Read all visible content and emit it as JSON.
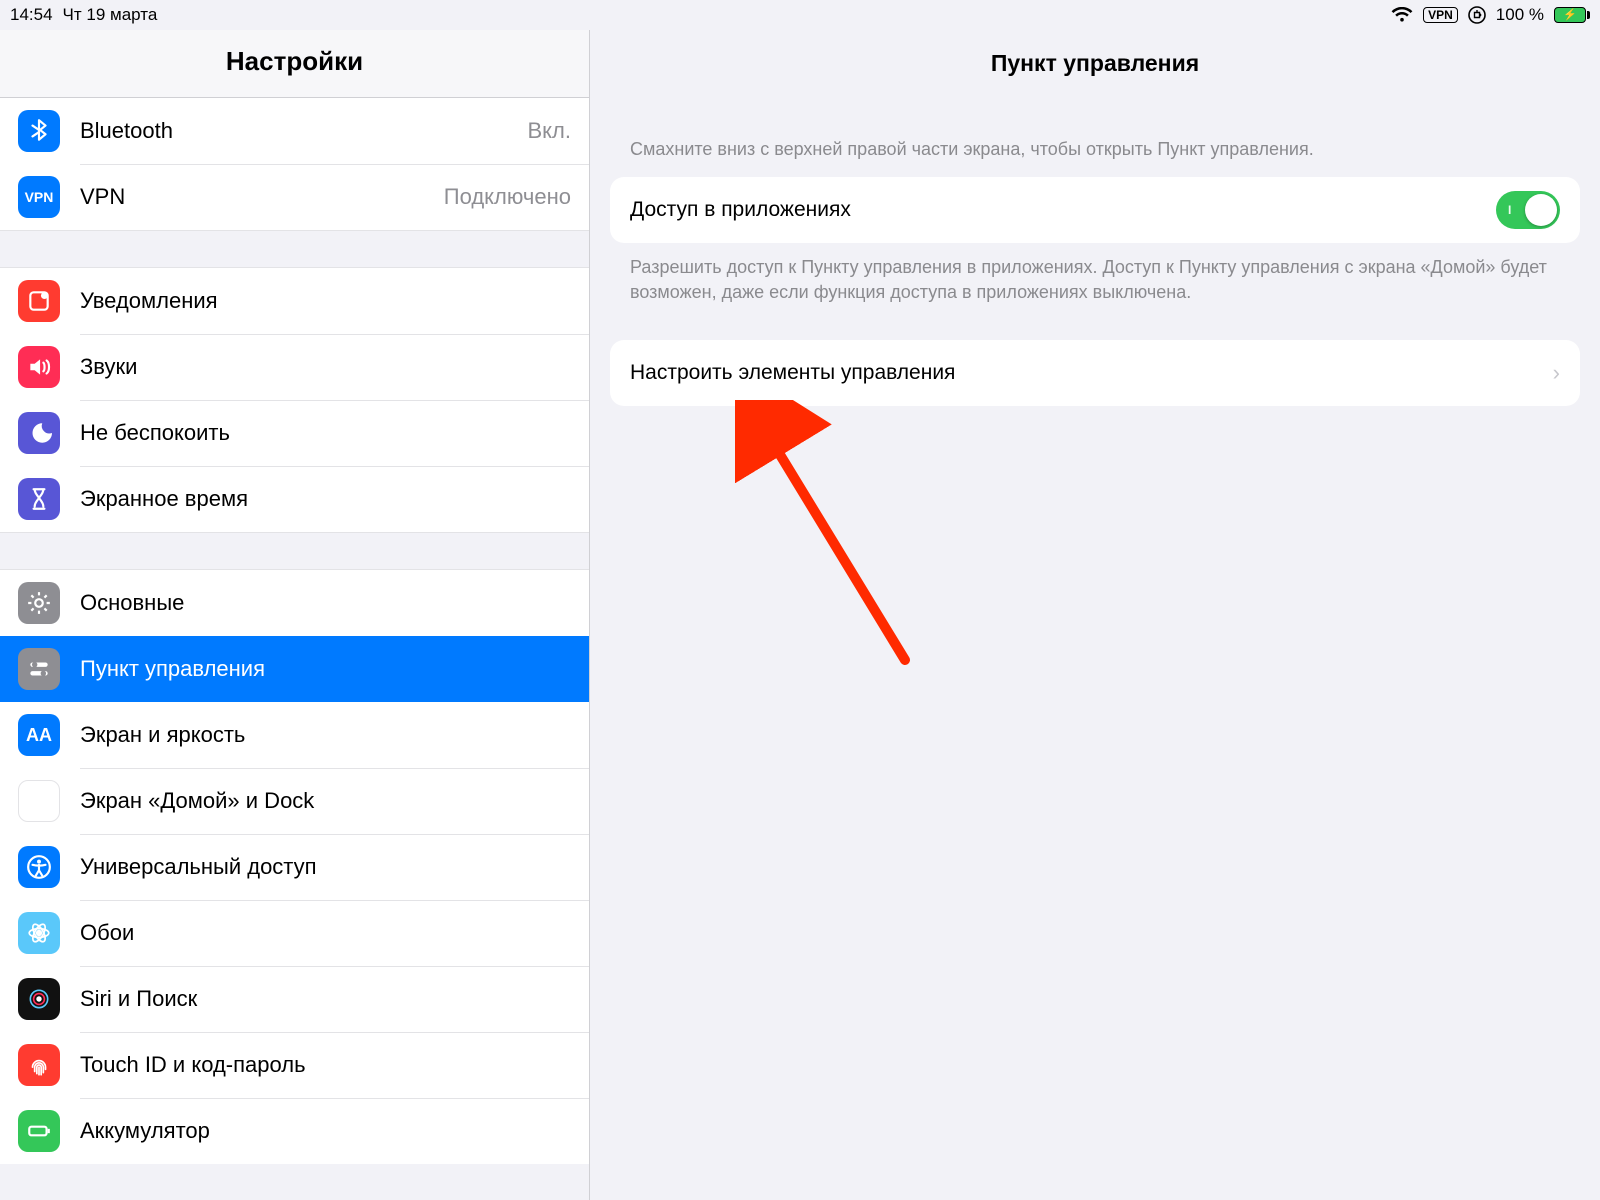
{
  "status": {
    "time": "14:54",
    "date": "Чт 19 марта",
    "vpn_badge": "VPN",
    "battery_pct": "100 %"
  },
  "sidebar": {
    "title": "Настройки",
    "groups": [
      {
        "items": [
          {
            "id": "bluetooth",
            "label": "Bluetooth",
            "value": "Вкл.",
            "icon": "bluetooth",
            "color": "c-blue"
          },
          {
            "id": "vpn",
            "label": "VPN",
            "value": "Подключено",
            "icon": "vpn",
            "color": "c-blue"
          }
        ]
      },
      {
        "items": [
          {
            "id": "notifications",
            "label": "Уведомления",
            "icon": "notifications",
            "color": "c-red"
          },
          {
            "id": "sounds",
            "label": "Звуки",
            "icon": "sounds",
            "color": "c-pink"
          },
          {
            "id": "dnd",
            "label": "Не беспокоить",
            "icon": "moon",
            "color": "c-purple"
          },
          {
            "id": "screentime",
            "label": "Экранное время",
            "icon": "hourglass",
            "color": "c-purple"
          }
        ]
      },
      {
        "items": [
          {
            "id": "general",
            "label": "Основные",
            "icon": "gear",
            "color": "c-gray"
          },
          {
            "id": "control-center",
            "label": "Пункт управления",
            "icon": "switches",
            "color": "c-gray",
            "selected": true
          },
          {
            "id": "display",
            "label": "Экран и яркость",
            "icon": "aa",
            "color": "c-blue"
          },
          {
            "id": "home-dock",
            "label": "Экран «Домой» и Dock",
            "icon": "grid",
            "color": "home-dock"
          },
          {
            "id": "accessibility",
            "label": "Универсальный доступ",
            "icon": "accessibility",
            "color": "c-blue"
          },
          {
            "id": "wallpaper",
            "label": "Обои",
            "icon": "flower",
            "color": "c-cyan"
          },
          {
            "id": "siri",
            "label": "Siri и Поиск",
            "icon": "siri",
            "color": "c-multi"
          },
          {
            "id": "touchid",
            "label": "Touch ID и код-пароль",
            "icon": "fingerprint",
            "color": "c-red"
          },
          {
            "id": "battery",
            "label": "Аккумулятор",
            "icon": "battery",
            "color": "c-green"
          }
        ]
      }
    ]
  },
  "detail": {
    "title": "Пункт управления",
    "hint": "Смахните вниз с верхней правой части экрана, чтобы открыть Пункт управления.",
    "access_in_apps": {
      "label": "Доступ в приложениях",
      "enabled": true
    },
    "access_footer": "Разрешить доступ к Пункту управления в приложениях. Доступ к Пункту управления с экрана «Домой» будет возможен, даже если функция доступа в приложениях выключена.",
    "customize": {
      "label": "Настроить элементы управления"
    }
  },
  "annotation": {
    "arrow_target": "customize-controls-cell"
  }
}
